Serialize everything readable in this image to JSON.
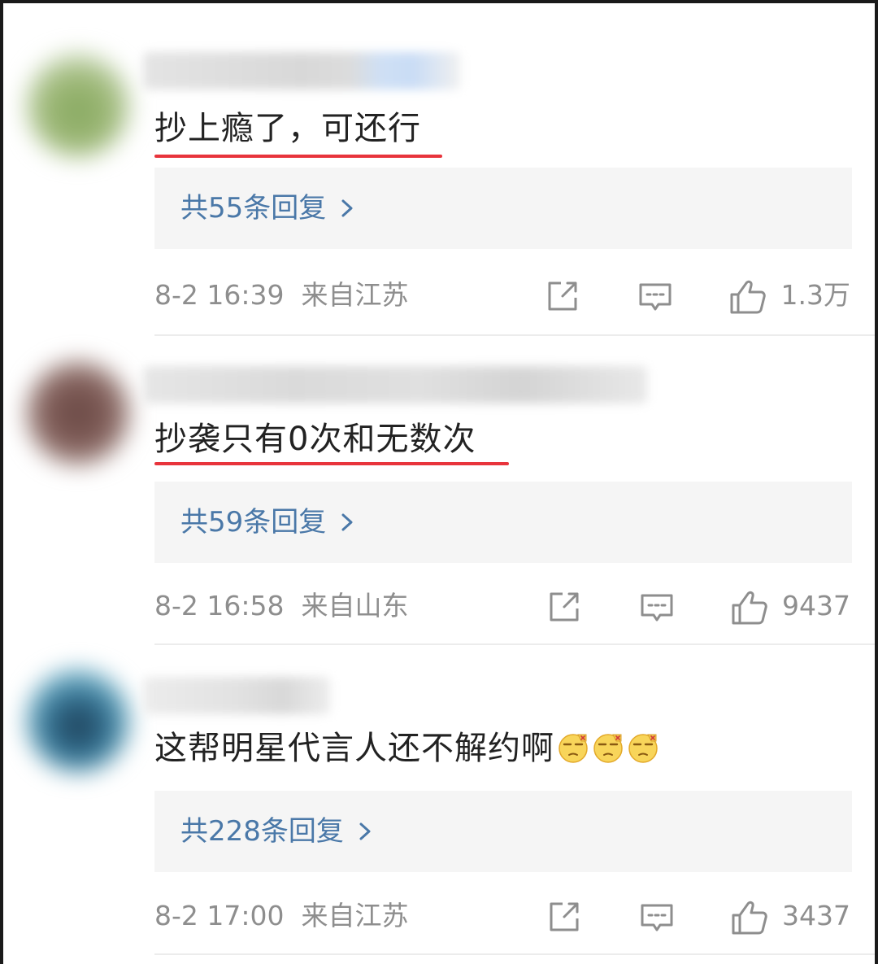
{
  "comments": [
    {
      "text": "抄上瘾了，可还行",
      "reply_summary": "共55条回复",
      "timestamp": "8-2 16:39",
      "location": "来自江苏",
      "likes": "1.3万"
    },
    {
      "text": "抄袭只有0次和无数次",
      "reply_summary": "共59条回复",
      "timestamp": "8-2 16:58",
      "location": "来自山东",
      "likes": "9437"
    },
    {
      "text": "这帮明星代言人还不解约啊",
      "emoji": [
        "facepalm-emoji",
        "facepalm-emoji",
        "facepalm-emoji"
      ],
      "reply_summary": "共228条回复",
      "timestamp": "8-2 17:00",
      "location": "来自江苏",
      "likes": "3437"
    }
  ],
  "icons": {
    "share": "share-icon",
    "comment": "comment-icon",
    "like": "thumbs-up-icon",
    "chevron": "chevron-right-icon"
  },
  "colors": {
    "highlight_underline": "#e8343c",
    "link": "#4a78a8",
    "meta_text": "#8e8e8e",
    "reply_box_bg": "#f5f5f5"
  }
}
